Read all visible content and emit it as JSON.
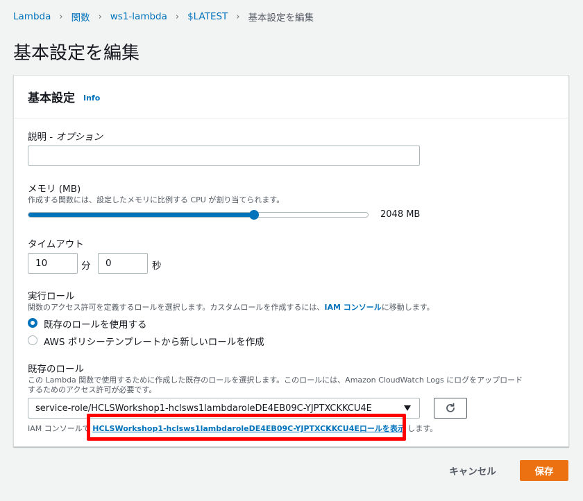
{
  "breadcrumb": {
    "items": [
      "Lambda",
      "関数",
      "ws1-lambda",
      "$LATEST"
    ],
    "current": "基本設定を編集"
  },
  "page_title": "基本設定を編集",
  "panel": {
    "title": "基本設定",
    "info": "Info"
  },
  "description": {
    "label": "説明 - ",
    "label_optional": "オプション",
    "value": ""
  },
  "memory": {
    "label": "メモリ (MB)",
    "hint": "作成する関数には、設定したメモリに比例する CPU が割り当てられます。",
    "value_text": "2048 MB",
    "fraction": 0.664
  },
  "timeout": {
    "label": "タイムアウト",
    "minutes": "10",
    "minutes_unit": "分",
    "seconds": "0",
    "seconds_unit": "秒"
  },
  "execution_role": {
    "label": "実行ロール",
    "hint_before": "関数のアクセス許可を定義するロールを選択します。カスタムロールを作成するには、",
    "hint_link": "IAM コンソール",
    "hint_after": "に移動します。",
    "options": [
      {
        "label": "既存のロールを使用する",
        "checked": true
      },
      {
        "label": "AWS ポリシーテンプレートから新しいロールを作成",
        "checked": false
      }
    ]
  },
  "existing_role": {
    "label": "既存のロール",
    "hint_line1": "この Lambda 関数で使用するために作成した既存のロールを選択します。このロールには、Amazon CloudWatch Logs にログをアップロード",
    "hint_line2": "するためのアクセス許可が必要です。",
    "selected": "service-role/HCLSWorkshop1-hclsws1lambdaroleDE4EB09C-YJPTXCKKCU4E",
    "footer_before": "IAM コンソールで ",
    "footer_link": "HCLSWorkshop1-hclsws1lambdaroleDE4EB09C-YJPTXCKKCU4Eロールを表示",
    "footer_after": " します。"
  },
  "actions": {
    "cancel": "キャンセル",
    "save": "保存"
  },
  "colors": {
    "link": "#0073bb",
    "primary": "#ec7211",
    "highlight": "#ff0000"
  }
}
